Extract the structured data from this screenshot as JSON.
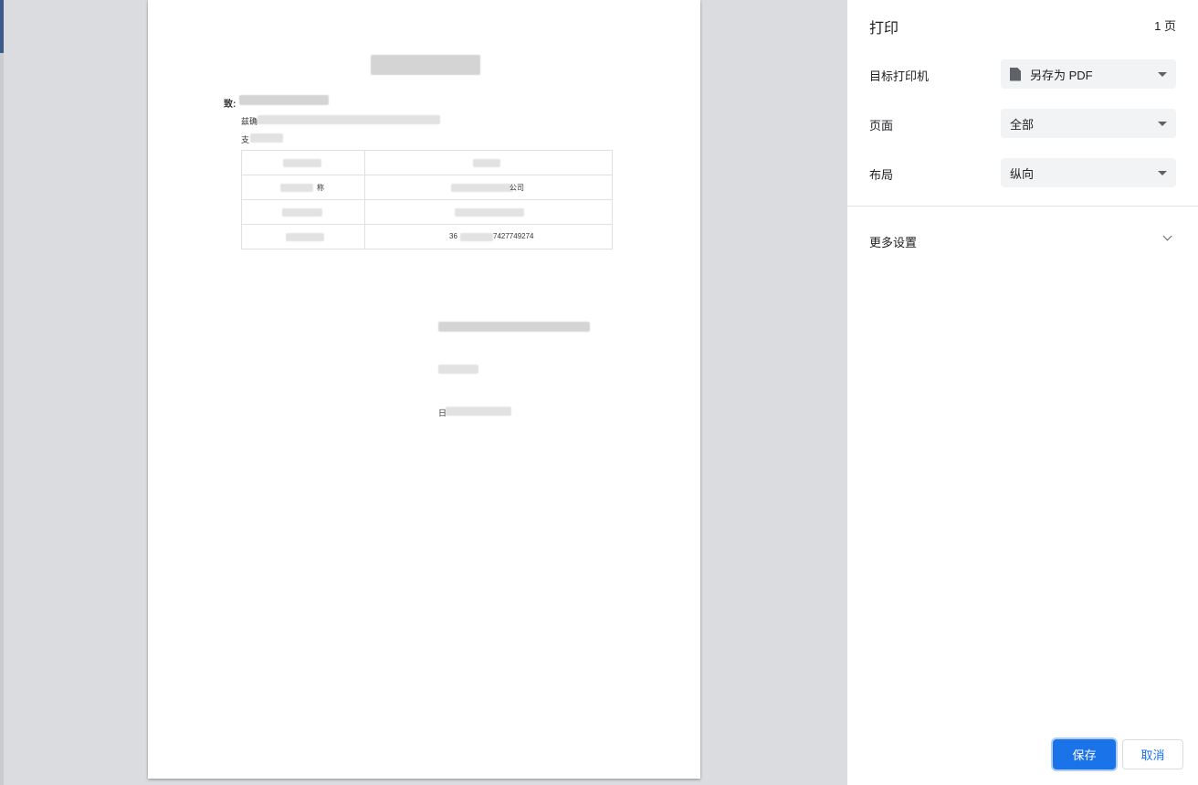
{
  "dialog": {
    "title": "打印",
    "page_count": "1 页"
  },
  "settings": {
    "destination": {
      "label": "目标打印机",
      "value": "另存为 PDF",
      "icon": "document-icon"
    },
    "pages": {
      "label": "页面",
      "value": "全部"
    },
    "layout": {
      "label": "布局",
      "value": "纵向"
    },
    "more": {
      "label": "更多设置"
    }
  },
  "buttons": {
    "save": "保存",
    "cancel": "取消"
  },
  "document": {
    "to_prefix": "致:",
    "line1_prefix": "兹确",
    "line2_prefix": "支",
    "table": [
      {
        "label": "",
        "value": ""
      },
      {
        "label": "称",
        "value": "公司"
      },
      {
        "label": "",
        "value": ""
      },
      {
        "label": "",
        "value": "36"
      }
    ],
    "id_suffix": "7427749274",
    "date_prefix": "日"
  },
  "colors": {
    "accent": "#1a73e8",
    "select_bg": "#f1f3f4",
    "preview_bg": "#dadce0"
  }
}
